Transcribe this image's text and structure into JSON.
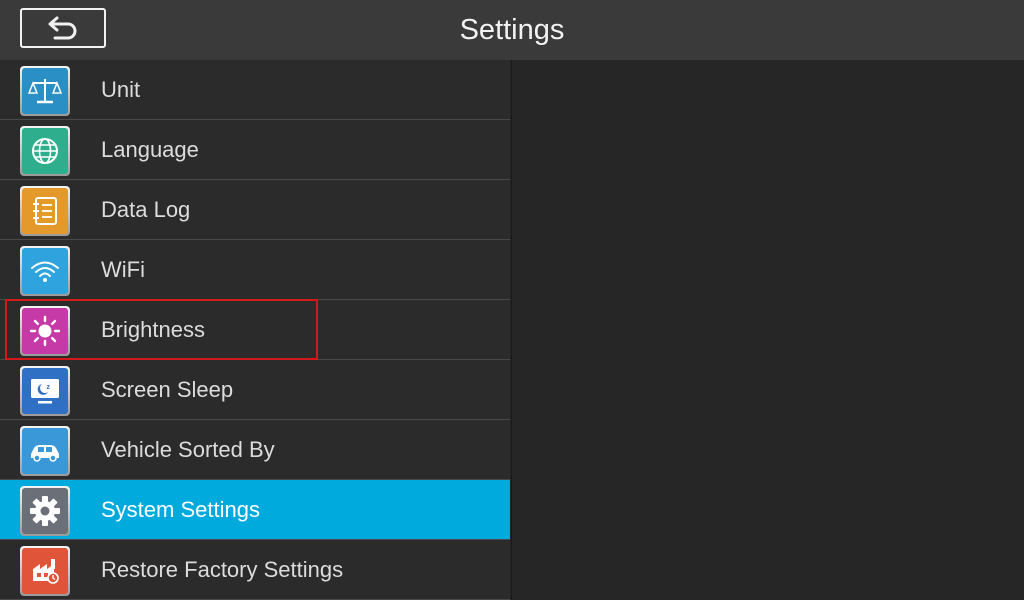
{
  "header": {
    "title": "Settings",
    "back_icon": "back-arrow-icon"
  },
  "menu": {
    "items": [
      {
        "label": "Unit",
        "icon": "scale-icon",
        "color": "#2a8fc4",
        "selected": false
      },
      {
        "label": "Language",
        "icon": "globe-icon",
        "color": "#2fae8e",
        "selected": false
      },
      {
        "label": "Data Log",
        "icon": "notebook-icon",
        "color": "#e39a2a",
        "selected": false
      },
      {
        "label": "WiFi",
        "icon": "wifi-icon",
        "color": "#2fa3de",
        "selected": false
      },
      {
        "label": "Brightness",
        "icon": "sun-icon",
        "color": "#c63aa8",
        "selected": false
      },
      {
        "label": "Screen Sleep",
        "icon": "monitor-sleep-icon",
        "color": "#3070c4",
        "selected": false
      },
      {
        "label": "Vehicle Sorted By",
        "icon": "car-icon",
        "color": "#3a98d8",
        "selected": false
      },
      {
        "label": "System Settings",
        "icon": "gear-icon",
        "color": "#6a6f78",
        "selected": true
      },
      {
        "label": "Restore Factory Settings",
        "icon": "factory-reset-icon",
        "color": "#e0553a",
        "selected": false
      }
    ]
  },
  "colors": {
    "selected_row": "#00aadd",
    "highlight_border": "#d21a1a"
  }
}
